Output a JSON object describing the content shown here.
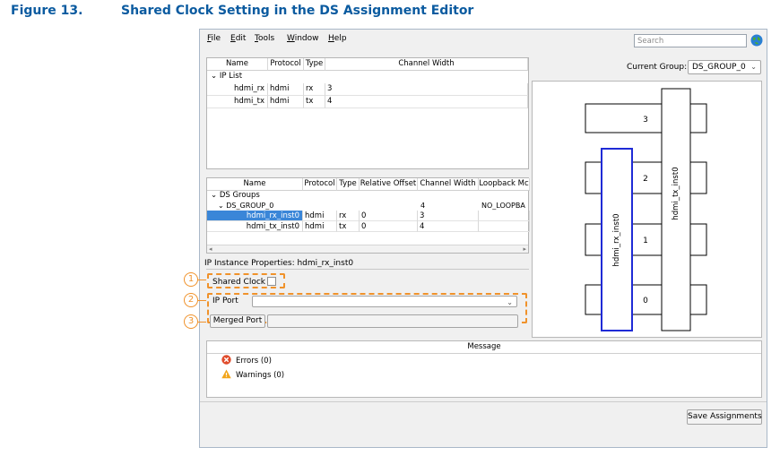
{
  "figure": {
    "number": "Figure 13.",
    "title": "Shared Clock Setting in the DS Assignment Editor"
  },
  "menu": [
    {
      "mnemonic": "F",
      "rest": "ile"
    },
    {
      "mnemonic": "E",
      "rest": "dit"
    },
    {
      "mnemonic": "T",
      "rest": "ools"
    },
    {
      "mnemonic": "W",
      "rest": "indow"
    },
    {
      "mnemonic": "H",
      "rest": "elp"
    }
  ],
  "search": {
    "placeholder": "Search"
  },
  "ip_table": {
    "headers": [
      "Name",
      "Protocol",
      "Type",
      "Channel Width"
    ],
    "group": "IP List",
    "rows": [
      {
        "name": "hdmi_rx",
        "protocol": "hdmi",
        "type": "rx",
        "width": "3"
      },
      {
        "name": "hdmi_tx",
        "protocol": "hdmi",
        "type": "tx",
        "width": "4"
      }
    ]
  },
  "ds_table": {
    "headers": [
      "Name",
      "Protocol",
      "Type",
      "Relative Offset",
      "Channel Width",
      "Loopback Mc"
    ],
    "group": "DS Groups",
    "subgroup": {
      "name": "DS_GROUP_0",
      "width": "4",
      "loopback": "NO_LOOPBA"
    },
    "rows": [
      {
        "name": "hdmi_rx_inst0",
        "protocol": "hdmi",
        "type": "rx",
        "offset": "0",
        "width": "3",
        "selected": true
      },
      {
        "name": "hdmi_tx_inst0",
        "protocol": "hdmi",
        "type": "tx",
        "offset": "0",
        "width": "4",
        "selected": false
      }
    ]
  },
  "properties": {
    "title": "IP Instance Properties: hdmi_rx_inst0",
    "shared_clock_label": "Shared Clock",
    "shared_clock_checked": false,
    "ip_port_label": "IP Port",
    "merged_port_label": "Merged Port",
    "callouts": [
      "1",
      "2",
      "3"
    ]
  },
  "current_group": {
    "label": "Current Group:",
    "value": "DS_GROUP_0"
  },
  "diagram": {
    "channels": [
      "3",
      "2",
      "1",
      "0"
    ],
    "rx_label": "hdmi_rx_inst0",
    "tx_label": "hdmi_tx_inst0",
    "rx_color": "#1f2bd6"
  },
  "messages": {
    "header": "Message",
    "errors": "Errors (0)",
    "warnings": "Warnings (0)"
  },
  "save_button": "Save Assignments",
  "colors": {
    "title": "#0b5ba0",
    "highlight": "#f0922b",
    "selection": "#3a86d8"
  }
}
